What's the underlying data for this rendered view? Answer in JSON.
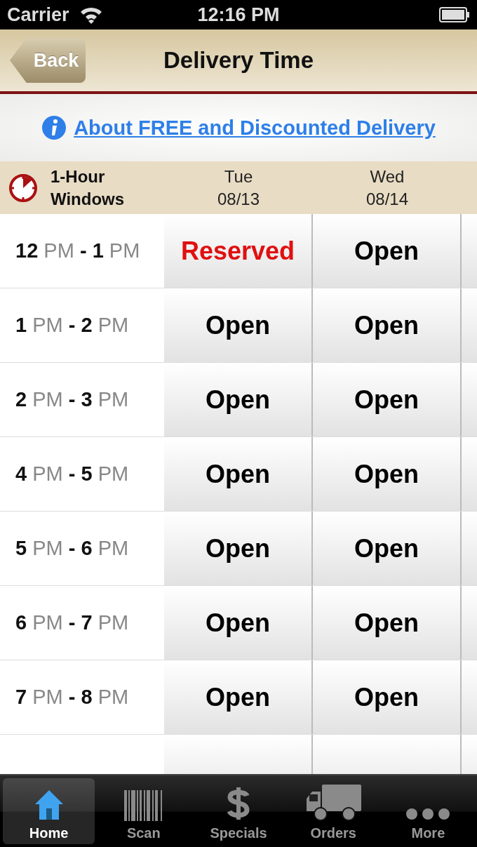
{
  "status_bar": {
    "carrier": "Carrier",
    "time": "12:16 PM"
  },
  "nav_bar": {
    "back": "Back",
    "title": "Delivery Time"
  },
  "banner": {
    "link": "About FREE and Discounted Delivery"
  },
  "table": {
    "corner": "1-Hour Windows",
    "columns": [
      {
        "day": "Tue",
        "date": "08/13"
      },
      {
        "day": "Wed",
        "date": "08/14"
      }
    ],
    "rows": [
      {
        "time": "**12** PM **-** **1** PM",
        "cells": [
          {
            "label": "Reserved",
            "reserved": true
          },
          {
            "label": "Open",
            "reserved": false
          }
        ]
      },
      {
        "time": "**1** PM **-** **2** PM",
        "cells": [
          {
            "label": "Open",
            "reserved": false
          },
          {
            "label": "Open",
            "reserved": false
          }
        ]
      },
      {
        "time": "**2** PM **-** **3** PM",
        "cells": [
          {
            "label": "Open",
            "reserved": false
          },
          {
            "label": "Open",
            "reserved": false
          }
        ]
      },
      {
        "time": "**4** PM **-** **5** PM",
        "cells": [
          {
            "label": "Open",
            "reserved": false
          },
          {
            "label": "Open",
            "reserved": false
          }
        ]
      },
      {
        "time": "**5** PM **-** **6** PM",
        "cells": [
          {
            "label": "Open",
            "reserved": false
          },
          {
            "label": "Open",
            "reserved": false
          }
        ]
      },
      {
        "time": "**6** PM **-** **7** PM",
        "cells": [
          {
            "label": "Open",
            "reserved": false
          },
          {
            "label": "Open",
            "reserved": false
          }
        ]
      },
      {
        "time": "**7** PM **-** **8** PM",
        "cells": [
          {
            "label": "Open",
            "reserved": false
          },
          {
            "label": "Open",
            "reserved": false
          }
        ]
      }
    ]
  },
  "tab_bar": [
    {
      "label": "Home",
      "kind": "home",
      "selected": true
    },
    {
      "label": "Scan",
      "kind": "barcode",
      "selected": false
    },
    {
      "label": "Specials",
      "kind": "dollar",
      "selected": false
    },
    {
      "label": "Orders",
      "kind": "truck",
      "selected": false
    },
    {
      "label": "More",
      "kind": "more",
      "selected": false
    }
  ]
}
